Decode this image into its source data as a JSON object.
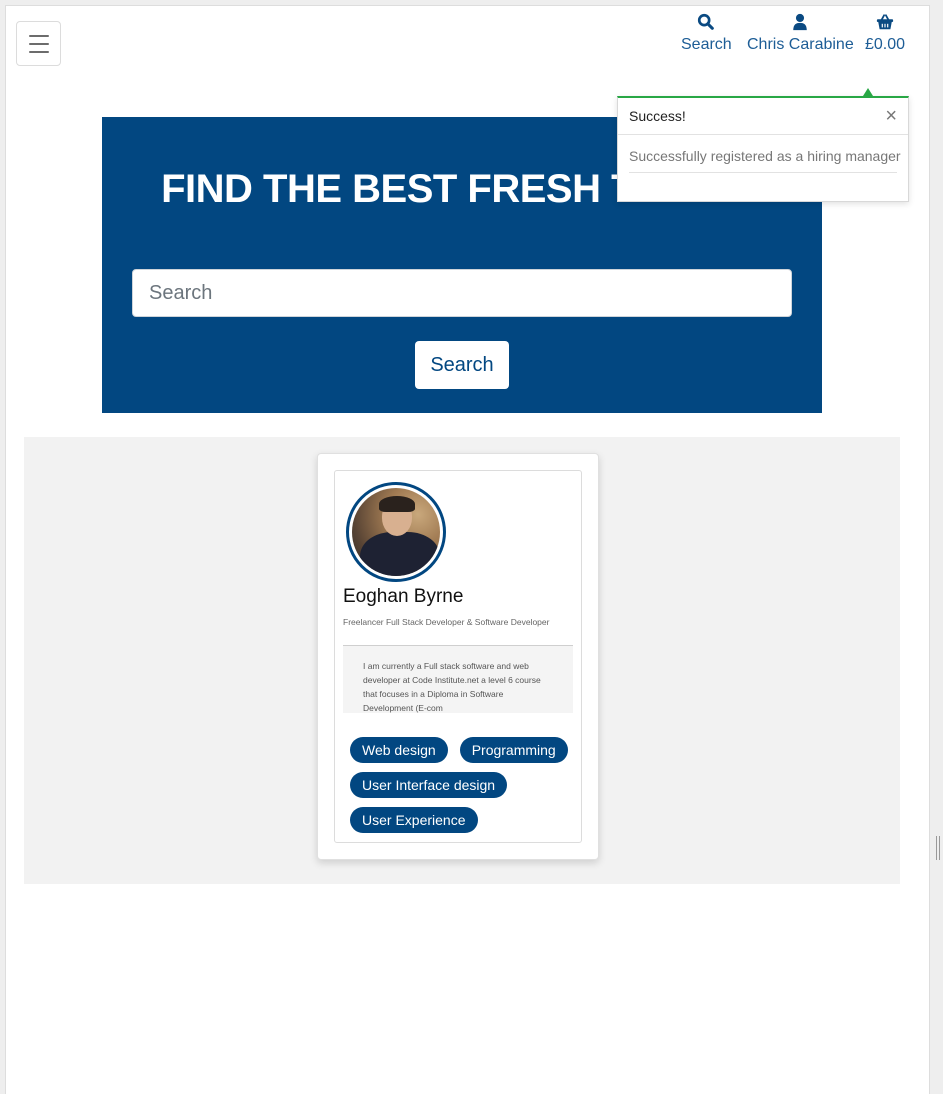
{
  "nav": {
    "search_label": "Search",
    "account_label": "Chris Carabine",
    "bag_label": "£0.00",
    "icons": {
      "menu": "hamburger-icon",
      "search": "search-icon",
      "account": "user-icon",
      "bag": "basket-icon"
    }
  },
  "toast": {
    "title": "Success!",
    "close": "×",
    "message": "Successfully registered as a hiring manager",
    "accent_color": "#28a745"
  },
  "hero": {
    "title": "FIND THE BEST FRESH TALENT",
    "search_placeholder": "Search",
    "search_button": "Search",
    "background_color": "#024781"
  },
  "results": {
    "cards": [
      {
        "name": "Eoghan Byrne",
        "subtitle": "Freelancer Full Stack Developer & Software Developer",
        "bio": "I am currently a Full stack software and web developer at Code Institute.net a level 6 course that focuses in a Diploma in Software Development (E-com",
        "tags": [
          "Web design",
          "Programming",
          "User Interface design",
          "User Experience"
        ]
      }
    ]
  }
}
